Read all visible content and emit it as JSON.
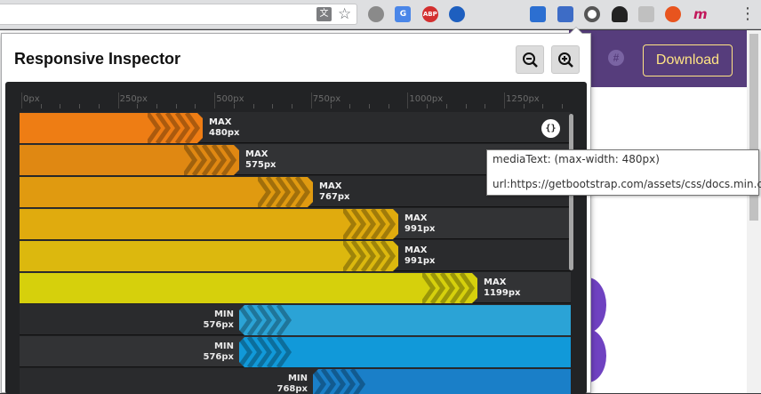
{
  "toolbar": {
    "translate_icon": "translate-icon",
    "star_icon": "bookmark-star-icon",
    "extensions": [
      {
        "name": "ext-circle-icon",
        "color": "#8a8a8a",
        "text": ""
      },
      {
        "name": "ext-google-translate-icon",
        "color": "#4a86e8",
        "text": "G"
      },
      {
        "name": "ext-adblock-icon",
        "color": "#d32f2f",
        "text": "ABP"
      },
      {
        "name": "ext-clock-icon",
        "color": "#1e5fbf",
        "text": ""
      },
      {
        "name": "ext-ninja-icon",
        "color": "#dedfe1",
        "text": ""
      },
      {
        "name": "ext-pencil-icon",
        "color": "#dedfe1",
        "text": ""
      },
      {
        "name": "ext-download-icon",
        "color": "#2c6fd1",
        "text": ""
      },
      {
        "name": "ext-responsive-inspector-icon",
        "color": "#3d6cc6",
        "text": ""
      },
      {
        "name": "ext-ring-icon",
        "color": "#555555",
        "text": ""
      },
      {
        "name": "ext-ghost-icon",
        "color": "#222222",
        "text": ""
      },
      {
        "name": "ext-puzzle-icon",
        "color": "#c0c0c0",
        "text": ""
      },
      {
        "name": "ext-fox-icon",
        "color": "#e8541e",
        "text": ""
      },
      {
        "name": "ext-m-icon",
        "color": "#dedfe1",
        "text": "m"
      }
    ],
    "menu_icon": "vertical-dots-icon"
  },
  "page": {
    "download_label": "Download",
    "header_color": "#563d7c"
  },
  "popup": {
    "title": "Responsive Inspector",
    "zoom_out_icon": "zoom-out-icon",
    "zoom_in_icon": "zoom-in-icon"
  },
  "ruler": {
    "ticks": [
      "0px",
      "250px",
      "500px",
      "750px",
      "1000px",
      "1250px"
    ]
  },
  "media_queries": [
    {
      "kind": "MAX",
      "value": "480px",
      "color": "#ee7d14"
    },
    {
      "kind": "MAX",
      "value": "575px",
      "color": "#e08812"
    },
    {
      "kind": "MAX",
      "value": "767px",
      "color": "#e09a10"
    },
    {
      "kind": "MAX",
      "value": "991px",
      "color": "#e0ab0e"
    },
    {
      "kind": "MAX",
      "value": "991px",
      "color": "#dcb80e"
    },
    {
      "kind": "MAX",
      "value": "1199px",
      "color": "#d6d00c"
    },
    {
      "kind": "MIN",
      "value": "576px",
      "color": "#2ba3d6"
    },
    {
      "kind": "MIN",
      "value": "576px",
      "color": "#1199d9"
    },
    {
      "kind": "MIN",
      "value": "768px",
      "color": "#1a7fc8"
    }
  ],
  "tooltip": {
    "media_text": "mediaText: (max-width: 480px)",
    "url": "url:https://getbootstrap.com/assets/css/docs.min.css"
  },
  "code_icon": "code-braces-icon"
}
